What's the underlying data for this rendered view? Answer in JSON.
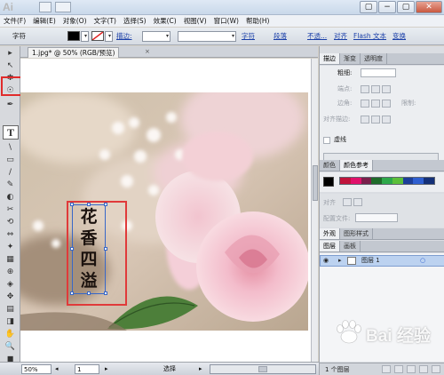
{
  "title_bar": {
    "logo": "Ai",
    "window_controls": [
      "▢",
      "−",
      "▢",
      "✕"
    ]
  },
  "menu": [
    "文件(F)",
    "编辑(E)",
    "对象(O)",
    "文字(T)",
    "选择(S)",
    "效果(C)",
    "视图(V)",
    "窗口(W)",
    "帮助(H)"
  ],
  "control_bar": {
    "label": "字符",
    "stroke_label": "描边:",
    "font_link": "字符",
    "para_link": "段落",
    "opacity_link": "不透...",
    "align_link": "对齐",
    "flash_link": "Flash 文本",
    "transform_link": "变换"
  },
  "document": {
    "tab_title": "1.jpg* @ 50% (RGB/预览)",
    "close_glyph": "×",
    "glyphs": [
      "花",
      "香",
      "四",
      "溢"
    ]
  },
  "tools": [
    "▸",
    "↖",
    "✱",
    "☉",
    "✒",
    "T",
    "\\",
    "▭",
    "/",
    "✎",
    "◐",
    "✂",
    "⟲",
    "⇔",
    "✦",
    "▦",
    "⊕",
    "◈",
    "✥",
    "▤",
    "◨",
    "✋",
    "🔍"
  ],
  "status_bar": {
    "zoom": "50%",
    "page": "1",
    "mode": "选择"
  },
  "stroke_panel": {
    "tabs": [
      "描边",
      "渐变",
      "透明度"
    ],
    "weight_label": "粗细:",
    "cap_label": "端点:",
    "corner_label": "边角:",
    "limit_label": "限制:",
    "align_label": "对齐描边:",
    "dashed_label": "虚线"
  },
  "color_panel": {
    "tabs": [
      "颜色",
      "颜色参考"
    ],
    "swatch_colors": [
      "#c0143c",
      "#e0106a",
      "#7a1f4c",
      "#1f6b2a",
      "#2ea84a",
      "#5bbf3a",
      "#1d3f9a",
      "#2f5fd0",
      "#143078"
    ]
  },
  "align_panel": {
    "align_label": "对齐",
    "ref_label": "配置文件:"
  },
  "appearance_panel": {
    "tabs": [
      "外观",
      "图形样式"
    ]
  },
  "layers_panel": {
    "tabs": [
      "图层",
      "画板"
    ],
    "layer_name": "图层 1",
    "footer": "1 个图层"
  },
  "watermark": {
    "text": "Bai 经验"
  }
}
